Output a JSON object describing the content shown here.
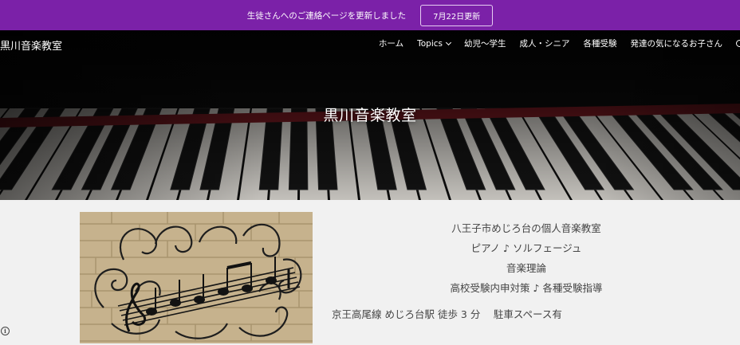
{
  "announcement": {
    "message": "生徒さんへのご連絡ページを更新しました",
    "button_label": "7月22日更新",
    "background": "#7b21a8"
  },
  "header": {
    "site_title": "黒川音楽教室",
    "nav": [
      "ホーム",
      "Topics",
      "幼児～学生",
      "成人・シニア",
      "各種受験",
      "発達の気になるお子さん"
    ],
    "search_icon": "search-icon"
  },
  "hero": {
    "title": "黒川音楽教室"
  },
  "intro": {
    "lines": [
      "八王子市めじろ台の個人音楽教室",
      "ピアノ ♪ ソルフェージュ",
      "音楽理論",
      "高校受験内申対策 ♪ 各種受験指導"
    ],
    "access": "京王高尾線 めじろ台駅 徒歩 3 分　 駐車スペース有"
  },
  "info_icon": "info-icon"
}
